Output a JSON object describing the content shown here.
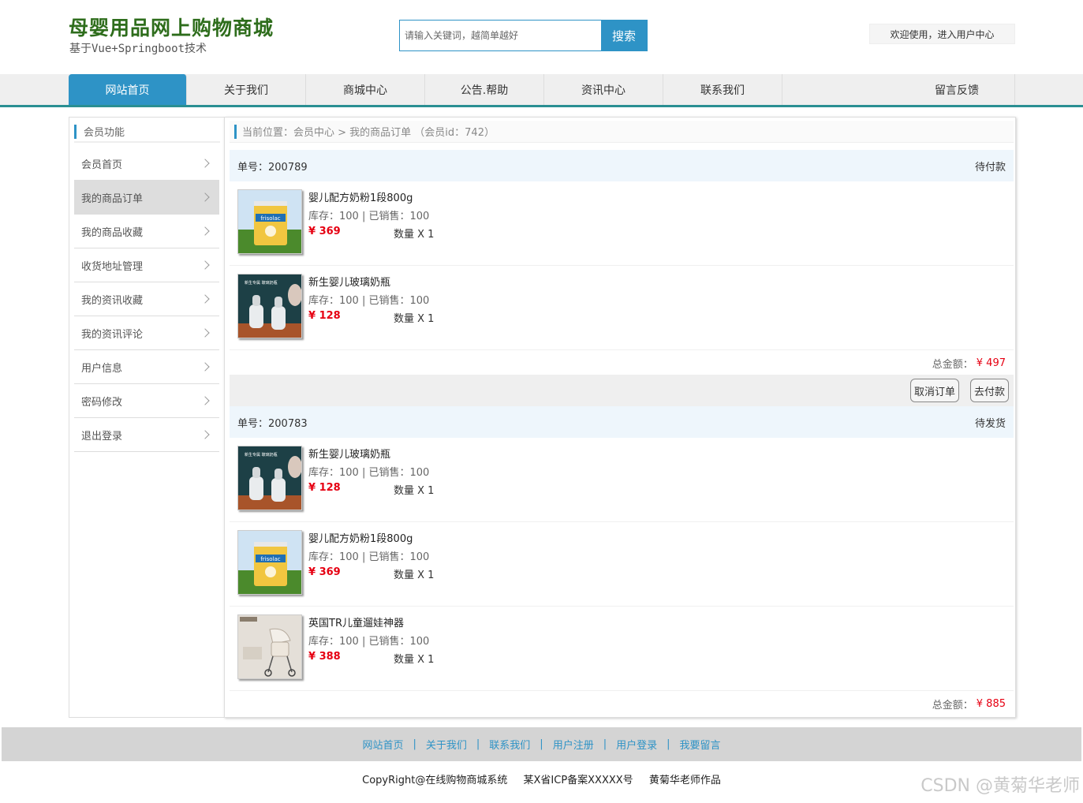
{
  "header": {
    "title": "母婴用品网上购物商城",
    "subtitle": "基于Vue+Springboot技术",
    "search_placeholder": "请输入关键词，越简单越好",
    "search_button": "搜索",
    "user_center": "欢迎使用，进入用户中心"
  },
  "nav": {
    "items": [
      "网站首页",
      "关于我们",
      "商城中心",
      "公告.帮助",
      "资讯中心",
      "联系我们",
      "留言反馈"
    ],
    "active": "网站首页"
  },
  "sidebar": {
    "title": "会员功能",
    "items": [
      "会员首页",
      "我的商品订单",
      "我的商品收藏",
      "收货地址管理",
      "我的资讯收藏",
      "我的资讯评论",
      "用户信息",
      "密码修改",
      "退出登录"
    ],
    "active": "我的商品订单"
  },
  "breadcrumb": "当前位置：会员中心 > 我的商品订单 （会员id：742）",
  "orders": [
    {
      "number": "单号：200789",
      "status": "待付款",
      "products": [
        {
          "name": "婴儿配方奶粉1段800g",
          "stock": "库存：100 | 已销售：100",
          "price": "¥ 369",
          "qty": "数量 X 1",
          "image": "formula-can"
        },
        {
          "name": "新生婴儿玻璃奶瓶",
          "stock": "库存：100 | 已销售：100",
          "price": "¥ 128",
          "qty": "数量 X 1",
          "image": "baby-bottle"
        }
      ],
      "total_label": "总金额：",
      "total": "¥ 497",
      "buttons": [
        "取消订单",
        "去付款"
      ]
    },
    {
      "number": "单号：200783",
      "status": "待发货",
      "products": [
        {
          "name": "新生婴儿玻璃奶瓶",
          "stock": "库存：100 | 已销售：100",
          "price": "¥ 128",
          "qty": "数量 X 1",
          "image": "baby-bottle"
        },
        {
          "name": "婴儿配方奶粉1段800g",
          "stock": "库存：100 | 已销售：100",
          "price": "¥ 369",
          "qty": "数量 X 1",
          "image": "formula-can"
        },
        {
          "name": "英国TR儿童遛娃神器",
          "stock": "库存：100 | 已销售：100",
          "price": "¥ 388",
          "qty": "数量 X 1",
          "image": "stroller"
        }
      ],
      "total_label": "总金额：",
      "total": "¥ 885"
    }
  ],
  "footer": {
    "links": [
      "网站首页",
      "关于我们",
      "联系我们",
      "用户注册",
      "用户登录",
      "我要留言"
    ],
    "copyright": "CopyRight@在线购物商城系统",
    "icp": "某X省ICP备案XXXXX号",
    "author": "黄菊华老师作品",
    "watermark": "CSDN @黄菊华老师"
  },
  "colors": {
    "brand_green": "#2e6d1c",
    "accent_blue": "#2e93c6",
    "nav_line": "#2a8f92",
    "price_red": "#e60012"
  }
}
